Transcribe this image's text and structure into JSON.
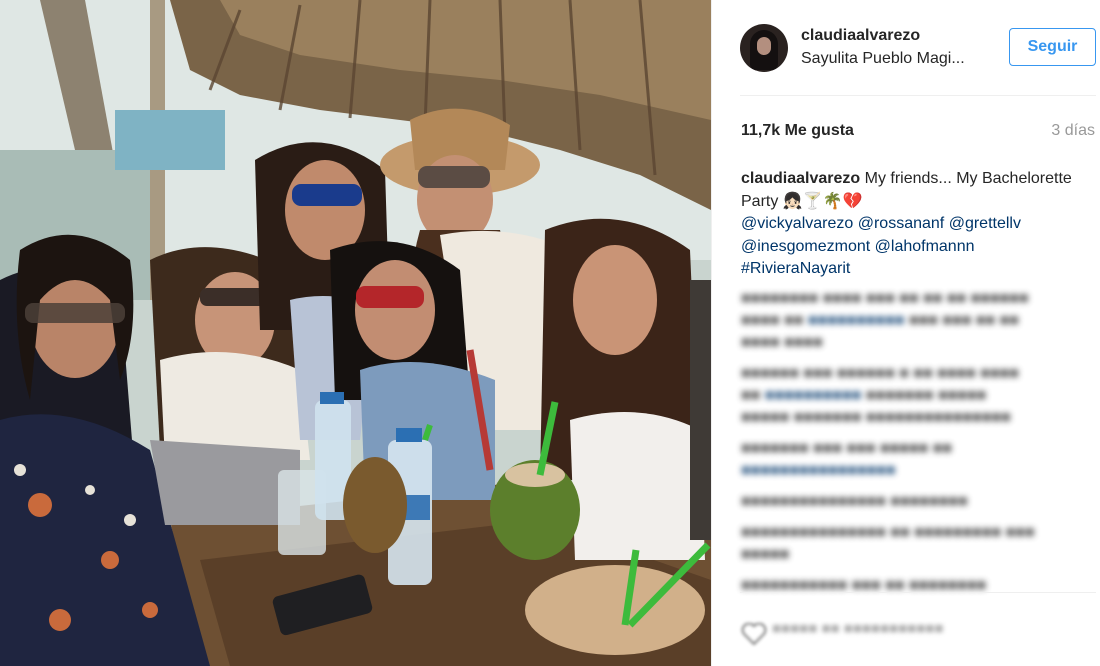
{
  "post": {
    "username": "claudiaalvarezo",
    "location": "Sayulita Pueblo Magi...",
    "follow_label": "Seguir",
    "likes": "11,7k Me gusta",
    "time_ago": "3 días",
    "caption_text": "My friends... My Bachelorette Party",
    "caption_emoji": "👧🏻🍸🌴💔",
    "mentions": [
      "@vickyalvarezo",
      "@rossananf",
      "@grettellv",
      "@inesgomezmont",
      "@lahofmannn"
    ],
    "hashtag": "#RivieraNayarit"
  },
  "colors": {
    "accent": "#3897f0",
    "link": "#003569",
    "muted": "#999999",
    "text": "#262626"
  },
  "icons": [
    "avatar",
    "heart-icon"
  ]
}
